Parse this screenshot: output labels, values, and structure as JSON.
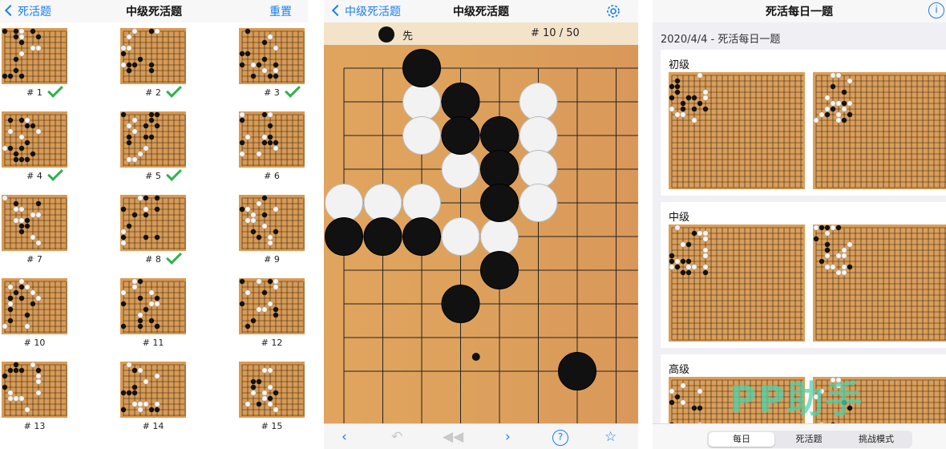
{
  "left": {
    "back_label": "死活题",
    "title": "中级死活题",
    "reset_label": "重置",
    "items": [
      {
        "label": "# 1",
        "solved": true
      },
      {
        "label": "# 2",
        "solved": true
      },
      {
        "label": "# 3",
        "solved": true
      },
      {
        "label": "# 4",
        "solved": true
      },
      {
        "label": "# 5",
        "solved": true
      },
      {
        "label": "# 6",
        "solved": false
      },
      {
        "label": "# 7",
        "solved": false
      },
      {
        "label": "# 8",
        "solved": true
      },
      {
        "label": "# 9",
        "solved": false
      },
      {
        "label": "# 10",
        "solved": false
      },
      {
        "label": "# 11",
        "solved": false
      },
      {
        "label": "# 12",
        "solved": false
      },
      {
        "label": "# 13",
        "solved": false
      },
      {
        "label": "# 14",
        "solved": false
      },
      {
        "label": "# 15",
        "solved": false
      }
    ]
  },
  "middle": {
    "back_label": "中级死活题",
    "title": "中级死活题",
    "turn_label": "先",
    "counter": "# 10 / 50",
    "toolbar_icons": [
      "back-icon",
      "undo-icon",
      "rewind-icon",
      "forward-icon",
      "help-icon",
      "star-icon"
    ],
    "board": {
      "size": 19,
      "black": [
        [
          2,
          0
        ],
        [
          3,
          1
        ],
        [
          3,
          2
        ],
        [
          4,
          2
        ],
        [
          4,
          3
        ],
        [
          4,
          4
        ],
        [
          0,
          5
        ],
        [
          1,
          5
        ],
        [
          2,
          5
        ],
        [
          4,
          6
        ],
        [
          3,
          7
        ],
        [
          6,
          9
        ]
      ],
      "white": [
        [
          2,
          1
        ],
        [
          2,
          2
        ],
        [
          5,
          1
        ],
        [
          3,
          3
        ],
        [
          5,
          2
        ],
        [
          5,
          3
        ],
        [
          0,
          4
        ],
        [
          1,
          4
        ],
        [
          2,
          4
        ],
        [
          5,
          4
        ],
        [
          3,
          5
        ],
        [
          4,
          5
        ]
      ]
    }
  },
  "right": {
    "title": "死活每日一题",
    "date_line": "2020/4/4 - 死活每日一题",
    "sections": [
      {
        "title": "初级"
      },
      {
        "title": "中级"
      },
      {
        "title": "高级"
      }
    ],
    "tabs": [
      "每日",
      "死活题",
      "挑战模式"
    ],
    "active_tab": 0,
    "watermark": "PP助手"
  }
}
